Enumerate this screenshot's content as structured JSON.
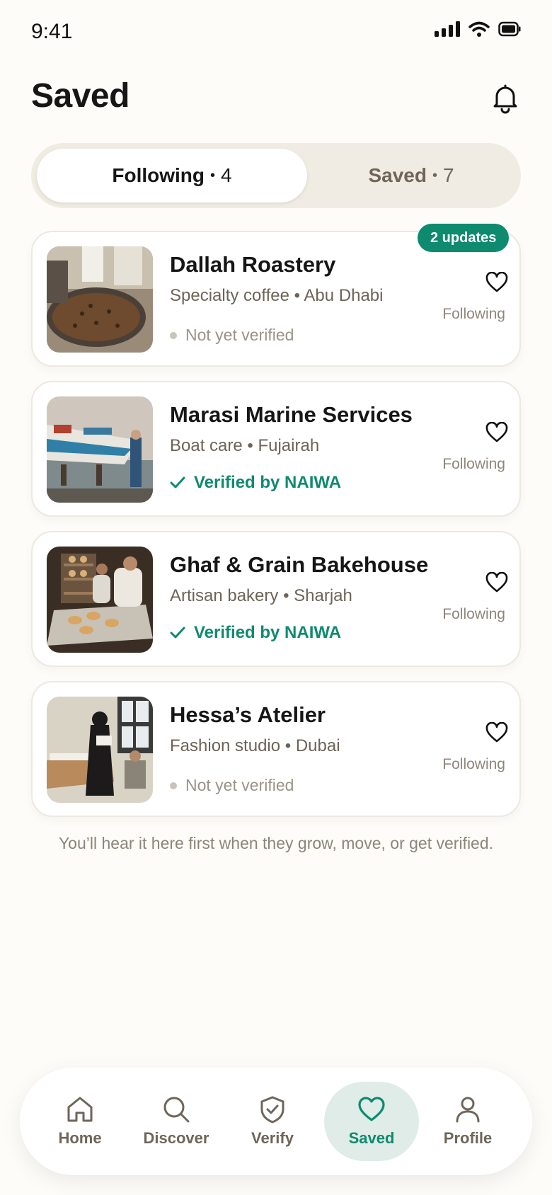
{
  "status_bar": {
    "time": "9:41"
  },
  "header": {
    "title": "Saved"
  },
  "segmented": {
    "active": {
      "label": "Following",
      "count": "4"
    },
    "inactive": {
      "label": "Saved",
      "count": "7"
    },
    "separator": "•"
  },
  "cards": [
    {
      "name": "Dallah Roastery",
      "subtitle": "Specialty coffee • Abu Dhabi",
      "status": "Not yet verified",
      "verified": false,
      "following_label": "Following",
      "badge": "2 updates"
    },
    {
      "name": "Marasi Marine Services",
      "subtitle": "Boat care • Fujairah",
      "status": "Verified by NAIWA",
      "verified": true,
      "following_label": "Following"
    },
    {
      "name": "Ghaf & Grain Bakehouse",
      "subtitle": "Artisan bakery • Sharjah",
      "status": "Verified by NAIWA",
      "verified": true,
      "following_label": "Following"
    },
    {
      "name": "Hessa’s Atelier",
      "subtitle": "Fashion studio • Dubai",
      "status": "Not yet verified",
      "verified": false,
      "following_label": "Following"
    }
  ],
  "footer_note": "You’ll hear it here first when they grow, move, or get verified.",
  "tabbar": {
    "items": [
      {
        "label": "Home",
        "icon": "home-icon"
      },
      {
        "label": "Discover",
        "icon": "search-icon"
      },
      {
        "label": "Verify",
        "icon": "shield-check-icon"
      },
      {
        "label": "Saved",
        "icon": "heart-icon",
        "active": true
      },
      {
        "label": "Profile",
        "icon": "person-icon"
      }
    ]
  },
  "colors": {
    "accent": "#0e8a6f",
    "background": "#fdfcf8",
    "segment_bg": "#f0ece3"
  }
}
